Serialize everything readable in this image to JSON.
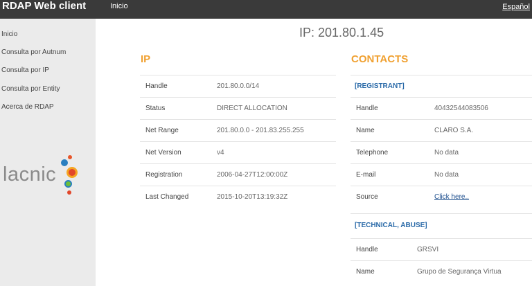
{
  "header": {
    "title": "RDAP Web client",
    "nav_inicio": "Inicio",
    "language": "Español"
  },
  "sidebar": {
    "items": [
      {
        "label": "Inicio"
      },
      {
        "label": "Consulta por Autnum"
      },
      {
        "label": "Consulta por IP"
      },
      {
        "label": "Consulta por Entity"
      },
      {
        "label": "Acerca de RDAP"
      }
    ],
    "logo_text": "lacnic"
  },
  "main": {
    "title": "IP: 201.80.1.45",
    "ip_section": {
      "title": "IP",
      "rows": [
        {
          "label": "Handle",
          "value": "201.80.0.0/14"
        },
        {
          "label": "Status",
          "value": "DIRECT ALLOCATION"
        },
        {
          "label": "Net Range",
          "value": "201.80.0.0 - 201.83.255.255"
        },
        {
          "label": "Net Version",
          "value": "v4"
        },
        {
          "label": "Registration",
          "value": "2006-04-27T12:00:00Z"
        },
        {
          "label": "Last Changed",
          "value": "2015-10-20T13:19:32Z"
        }
      ]
    },
    "contacts_section": {
      "title": "CONTACTS",
      "registrant": {
        "heading": "[REGISTRANT]",
        "rows": [
          {
            "label": "Handle",
            "value": "40432544083506"
          },
          {
            "label": "Name",
            "value": "CLARO S.A."
          },
          {
            "label": "Telephone",
            "value": "No data"
          },
          {
            "label": "E-mail",
            "value": "No data"
          },
          {
            "label": "Source",
            "value": "Click here.."
          }
        ]
      },
      "technical": {
        "heading": "[TECHNICAL, ABUSE]",
        "rows": [
          {
            "label": "Handle",
            "value": "GRSVI"
          },
          {
            "label": "Name",
            "value": "Grupo de Segurança Virtua"
          }
        ]
      }
    }
  },
  "colors": {
    "topbar": "#3a3a3a",
    "sidebar": "#ebebeb",
    "section_accent": "#f0a030",
    "subheading": "#2a6aa8",
    "link": "#1a4c8c"
  }
}
